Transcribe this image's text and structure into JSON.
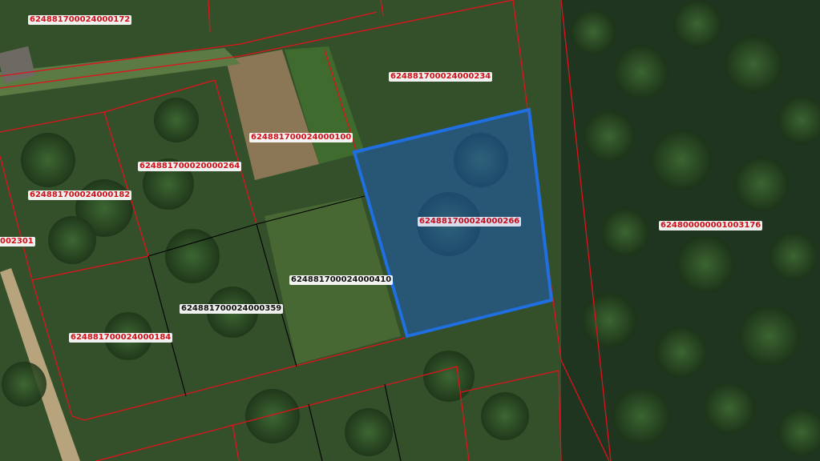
{
  "map": {
    "parcel_labels": [
      {
        "id": "p172",
        "text": "624881700024000172",
        "style": "red"
      },
      {
        "id": "p234",
        "text": "624881700024000234",
        "style": "red"
      },
      {
        "id": "p100",
        "text": "624881700024000100",
        "style": "red"
      },
      {
        "id": "p264",
        "text": "624881700020000264",
        "style": "red"
      },
      {
        "id": "p182",
        "text": "624881700024000182",
        "style": "red"
      },
      {
        "id": "p2301",
        "text": "002301",
        "style": "red"
      },
      {
        "id": "p266",
        "text": "624881700024000266",
        "style": "selected"
      },
      {
        "id": "p3176",
        "text": "624800000001003176",
        "style": "red"
      },
      {
        "id": "p410",
        "text": "624881700024000410",
        "style": "black"
      },
      {
        "id": "p359",
        "text": "624881700024000359",
        "style": "black"
      },
      {
        "id": "p184",
        "text": "624881700024000184",
        "style": "red"
      }
    ],
    "colors": {
      "registered_boundary": "#e0121c",
      "unregistered_boundary": "#000000",
      "selected_outline": "#1f6fe0",
      "selected_fill": "#1a5fd0"
    }
  }
}
